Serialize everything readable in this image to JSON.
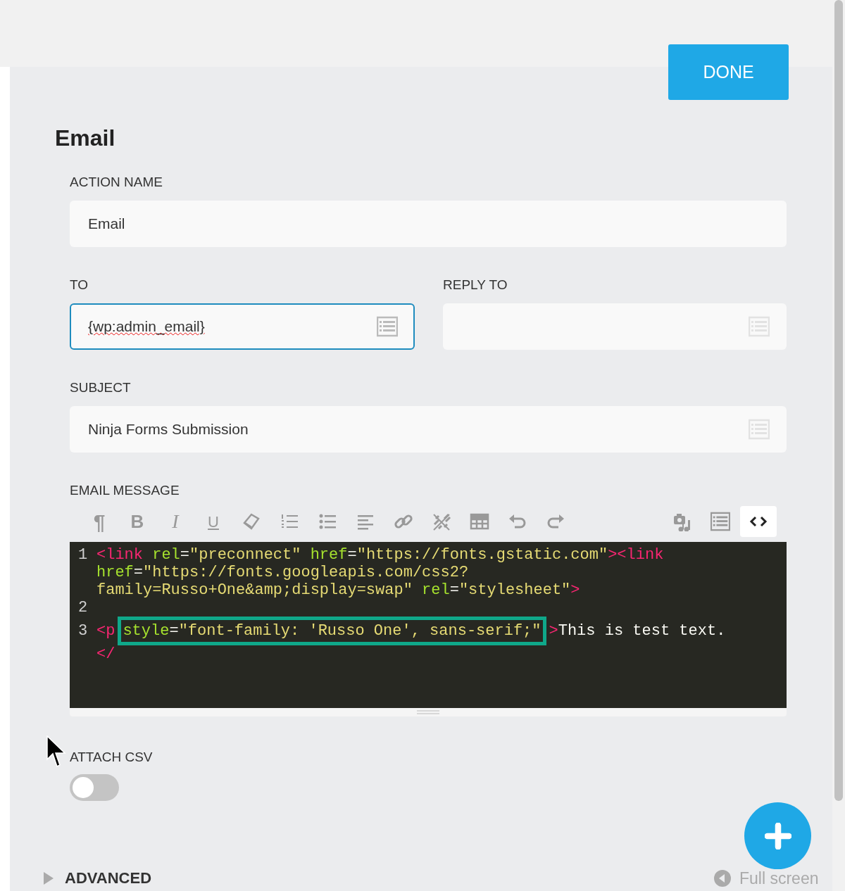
{
  "done_button": "DONE",
  "title": "Email",
  "fields": [
    {
      "label": "ACTION NAME",
      "value": "Email",
      "focused": false,
      "merge_tags": false,
      "misspelled": false
    },
    {
      "label": "TO",
      "value": "{wp:admin_email}",
      "focused": true,
      "merge_tags": true,
      "misspelled": true
    },
    {
      "label": "REPLY TO",
      "focused": false,
      "merge_tags": true,
      "misspelled": false
    },
    {
      "label": "SUBJECT",
      "value": "Ninja Forms Submission",
      "focused": false,
      "merge_tags": true,
      "misspelled": false
    }
  ],
  "email_message": {
    "label": "EMAIL MESSAGE",
    "toolbar": [
      {
        "kind": "glyph",
        "label": "¶",
        "selected": false
      },
      {
        "kind": "glyph",
        "label": "B",
        "selected": false
      },
      {
        "kind": "glyph",
        "label": "I",
        "selected": false
      },
      {
        "kind": "glyph",
        "label": "U",
        "selected": false
      },
      {
        "kind": "icon",
        "selected": false
      },
      {
        "kind": "icon",
        "selected": false
      },
      {
        "kind": "icon",
        "selected": false
      },
      {
        "kind": "icon",
        "selected": false
      },
      {
        "kind": "icon",
        "selected": false
      },
      {
        "kind": "icon",
        "selected": false
      },
      {
        "kind": "icon",
        "selected": false
      },
      {
        "kind": "icon",
        "selected": false
      },
      {
        "kind": "icon",
        "selected": false
      },
      {
        "kind": "spacer"
      },
      {
        "kind": "icon",
        "selected": false
      },
      {
        "kind": "icon",
        "selected": false
      },
      {
        "kind": "icon",
        "selected": true
      }
    ],
    "code_lines": [
      {
        "number": "1",
        "segments": [
          {
            "tokens": [
              {
                "kind": "tag",
                "text": "<link"
              },
              {
                "kind": "attr",
                "text": " rel"
              },
              {
                "kind": "text",
                "text": "="
              },
              {
                "kind": "string",
                "text": "\"preconnect\""
              },
              {
                "kind": "attr",
                "text": " href"
              },
              {
                "kind": "text",
                "text": "="
              },
              {
                "kind": "string",
                "text": "\"https://fonts.gstatic.com\""
              },
              {
                "kind": "tag",
                "text": "><link"
              }
            ]
          },
          {
            "tokens": [
              {
                "kind": "attr",
                "text": "href"
              },
              {
                "kind": "text",
                "text": "="
              },
              {
                "kind": "string",
                "text": "\"https://fonts.googleapis.com/css2?"
              }
            ]
          },
          {
            "tokens": [
              {
                "kind": "string",
                "text": "family=Russo+One&amp;display=swap\""
              },
              {
                "kind": "attr",
                "text": " rel"
              },
              {
                "kind": "text",
                "text": "="
              },
              {
                "kind": "string",
                "text": "\"stylesheet\""
              },
              {
                "kind": "tag",
                "text": ">"
              }
            ]
          }
        ]
      },
      {
        "number": "2"
      },
      {
        "number": "3",
        "segments": [
          {
            "tokens": [
              {
                "kind": "tag",
                "text": "<p",
                "highlighted": false
              },
              {
                "kind": "attr",
                "text": "style",
                "highlighted": true
              },
              {
                "kind": "text",
                "text": "=",
                "highlighted": true
              },
              {
                "kind": "string",
                "text": "\"font-family: 'Russo One', sans-serif;\"",
                "highlighted": true
              },
              {
                "kind": "tag",
                "text": ">",
                "highlighted": false
              },
              {
                "kind": "text",
                "text": "This is test text.",
                "highlighted": false
              }
            ]
          },
          {
            "tokens": [
              {
                "kind": "tag",
                "text": "</",
                "highlighted": false
              }
            ]
          }
        ]
      }
    ]
  },
  "attach_csv": {
    "label": "ATTACH CSV",
    "on": false
  },
  "advanced": {
    "label": "ADVANCED",
    "expanded": false
  },
  "full_screen": "Full screen"
}
